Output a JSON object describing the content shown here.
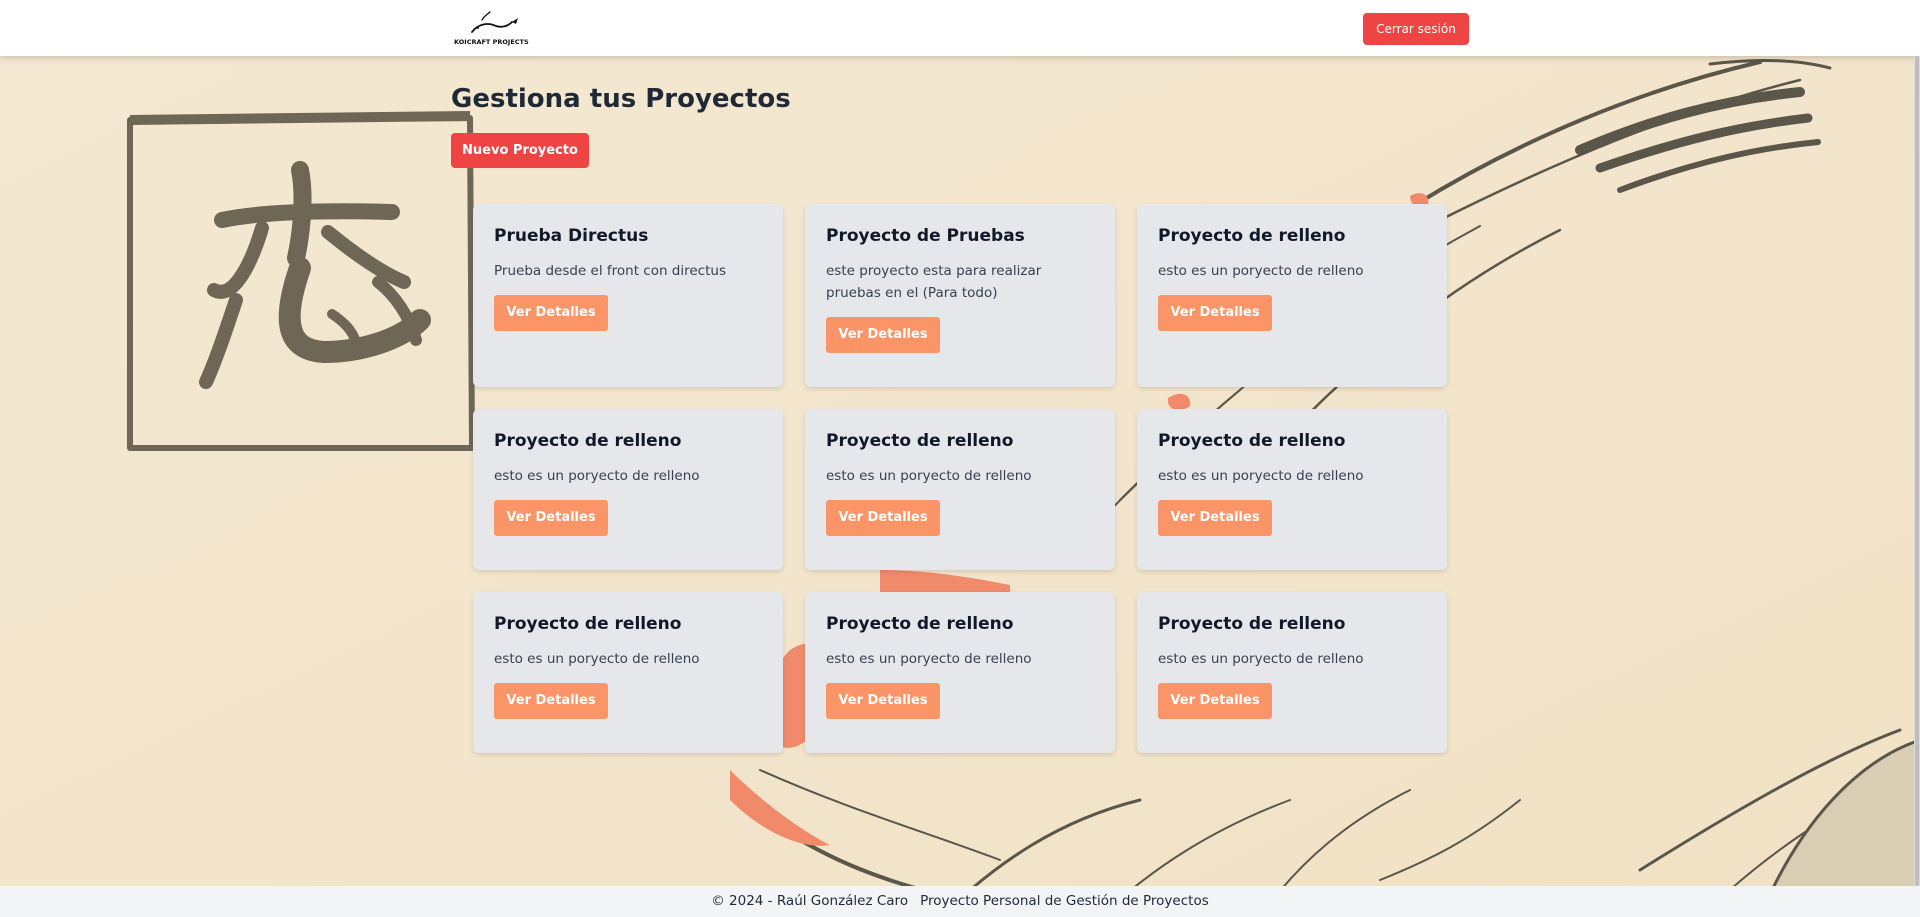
{
  "header": {
    "logo_text": "KOICRAFT PROJECTS",
    "logout_label": "Cerrar sesión"
  },
  "main": {
    "title": "Gestiona tus Proyectos",
    "new_project_label": "Nuevo Proyecto",
    "projects": [
      {
        "title": "Prueba Directus",
        "description": "Prueba desde el front con directus",
        "button": "Ver Detalles"
      },
      {
        "title": "Proyecto de Pruebas",
        "description": "este proyecto esta para realizar pruebas en el (Para todo)",
        "button": "Ver Detalles"
      },
      {
        "title": "Proyecto de relleno",
        "description": "esto es un poryecto de relleno",
        "button": "Ver Detalles"
      },
      {
        "title": "Proyecto de relleno",
        "description": "esto es un poryecto de relleno",
        "button": "Ver Detalles"
      },
      {
        "title": "Proyecto de relleno",
        "description": "esto es un poryecto de relleno",
        "button": "Ver Detalles"
      },
      {
        "title": "Proyecto de relleno",
        "description": "esto es un poryecto de relleno",
        "button": "Ver Detalles"
      },
      {
        "title": "Proyecto de relleno",
        "description": "esto es un poryecto de relleno",
        "button": "Ver Detalles"
      },
      {
        "title": "Proyecto de relleno",
        "description": "esto es un poryecto de relleno",
        "button": "Ver Detalles"
      },
      {
        "title": "Proyecto de relleno",
        "description": "esto es un poryecto de relleno",
        "button": "Ver Detalles"
      }
    ]
  },
  "footer": {
    "copyright": "© 2024 - Raúl González Caro",
    "subtitle": "Proyecto Personal de Gestión de Proyectos"
  },
  "colors": {
    "background": "#f3e6cc",
    "primary_red": "#ef4444",
    "details_orange": "#fb9466",
    "card_bg": "#e5e7eb",
    "koi_orange": "#f08a6b",
    "ink": "#6e6755"
  },
  "icons": {
    "logo": "koi-fish-logo",
    "background": "koi-fish-kanji-illustration"
  }
}
